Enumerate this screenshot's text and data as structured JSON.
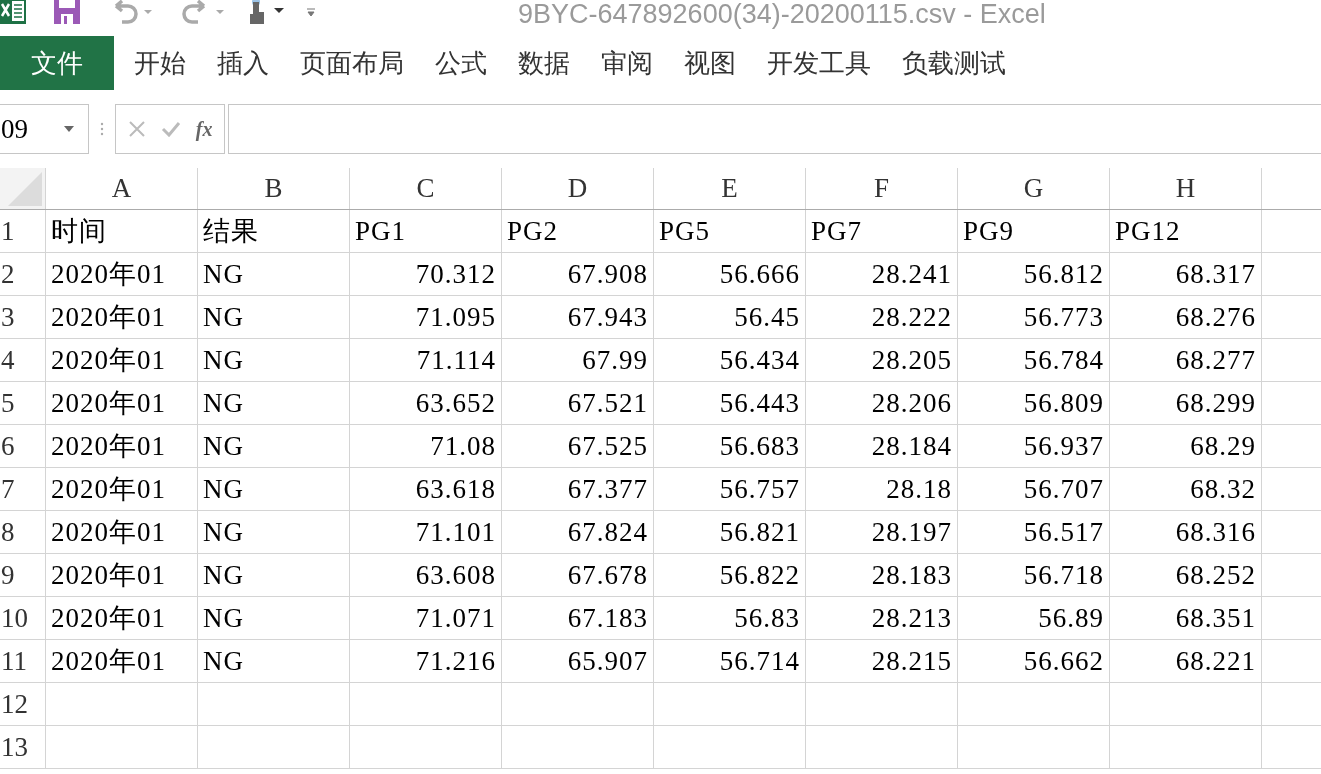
{
  "window": {
    "title": "9BYC-647892600(34)-20200115.csv - Excel"
  },
  "ribbon": {
    "file_button": "文件",
    "tabs": [
      "开始",
      "插入",
      "页面布局",
      "公式",
      "数据",
      "审阅",
      "视图",
      "开发工具",
      "负载测试"
    ]
  },
  "formula_bar": {
    "name_box": "09",
    "function_button": "fx"
  },
  "sheet": {
    "columns": [
      {
        "letter": "A",
        "kind": "text"
      },
      {
        "letter": "B",
        "kind": "text"
      },
      {
        "letter": "C",
        "kind": "number"
      },
      {
        "letter": "D",
        "kind": "number"
      },
      {
        "letter": "E",
        "kind": "number"
      },
      {
        "letter": "F",
        "kind": "number"
      },
      {
        "letter": "G",
        "kind": "number"
      },
      {
        "letter": "H",
        "kind": "number"
      }
    ],
    "header_row": {
      "number": "1",
      "cells": [
        "时间",
        "结果",
        "PG1",
        "PG2",
        "PG5",
        "PG7",
        "PG9",
        "PG12"
      ]
    },
    "rows": [
      {
        "number": "2",
        "cells": [
          "2020年01",
          "NG",
          "70.312",
          "67.908",
          "56.666",
          "28.241",
          "56.812",
          "68.317"
        ]
      },
      {
        "number": "3",
        "cells": [
          "2020年01",
          "NG",
          "71.095",
          "67.943",
          "56.45",
          "28.222",
          "56.773",
          "68.276"
        ]
      },
      {
        "number": "4",
        "cells": [
          "2020年01",
          "NG",
          "71.114",
          "67.99",
          "56.434",
          "28.205",
          "56.784",
          "68.277"
        ]
      },
      {
        "number": "5",
        "cells": [
          "2020年01",
          "NG",
          "63.652",
          "67.521",
          "56.443",
          "28.206",
          "56.809",
          "68.299"
        ]
      },
      {
        "number": "6",
        "cells": [
          "2020年01",
          "NG",
          "71.08",
          "67.525",
          "56.683",
          "28.184",
          "56.937",
          "68.29"
        ]
      },
      {
        "number": "7",
        "cells": [
          "2020年01",
          "NG",
          "63.618",
          "67.377",
          "56.757",
          "28.18",
          "56.707",
          "68.32"
        ]
      },
      {
        "number": "8",
        "cells": [
          "2020年01",
          "NG",
          "71.101",
          "67.824",
          "56.821",
          "28.197",
          "56.517",
          "68.316"
        ]
      },
      {
        "number": "9",
        "cells": [
          "2020年01",
          "NG",
          "63.608",
          "67.678",
          "56.822",
          "28.183",
          "56.718",
          "68.252"
        ]
      },
      {
        "number": "10",
        "cells": [
          "2020年01",
          "NG",
          "71.071",
          "67.183",
          "56.83",
          "28.213",
          "56.89",
          "68.351"
        ]
      },
      {
        "number": "11",
        "cells": [
          "2020年01",
          "NG",
          "71.216",
          "65.907",
          "56.714",
          "28.215",
          "56.662",
          "68.221"
        ]
      },
      {
        "number": "12"
      },
      {
        "number": "13"
      }
    ]
  }
}
